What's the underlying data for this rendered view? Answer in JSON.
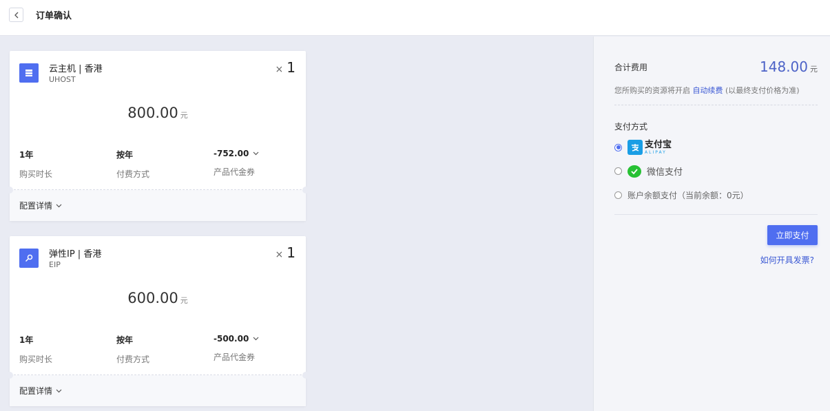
{
  "header": {
    "title": "订单确认"
  },
  "orders": [
    {
      "name": "云主机 | 香港",
      "code": "UHOST",
      "qty_x": "×",
      "qty": "1",
      "price": "800.00",
      "unit": "元",
      "duration": "1年",
      "duration_label": "购买时长",
      "billing": "按年",
      "billing_label": "付费方式",
      "coupon": "-752.00",
      "coupon_label": "产品代金券",
      "details": "配置详情",
      "icon": "server-icon"
    },
    {
      "name": "弹性IP | 香港",
      "code": "EIP",
      "qty_x": "×",
      "qty": "1",
      "price": "600.00",
      "unit": "元",
      "duration": "1年",
      "duration_label": "购买时长",
      "billing": "按年",
      "billing_label": "付费方式",
      "coupon": "-500.00",
      "coupon_label": "产品代金券",
      "details": "配置详情",
      "icon": "ip-icon"
    }
  ],
  "summary": {
    "total_label": "合计费用",
    "total": "148.00",
    "total_unit": "元",
    "renew_prefix": "您所购买的资源将开启",
    "renew_link": "自动续费",
    "renew_suffix": "(以最终支付价格为准)",
    "payment_title": "支付方式",
    "alipay_cn": "支付宝",
    "alipay_en": "ALIPAY",
    "wechat": "微信支付",
    "balance": "账户余额支付（当前余额：0元）",
    "pay_button": "立即支付",
    "invoice_link": "如何开具发票?"
  },
  "colors": {
    "accent": "#4f6ef0",
    "link": "#3b59d4",
    "alipay": "#1a9ee5",
    "wechat": "#27c134"
  }
}
